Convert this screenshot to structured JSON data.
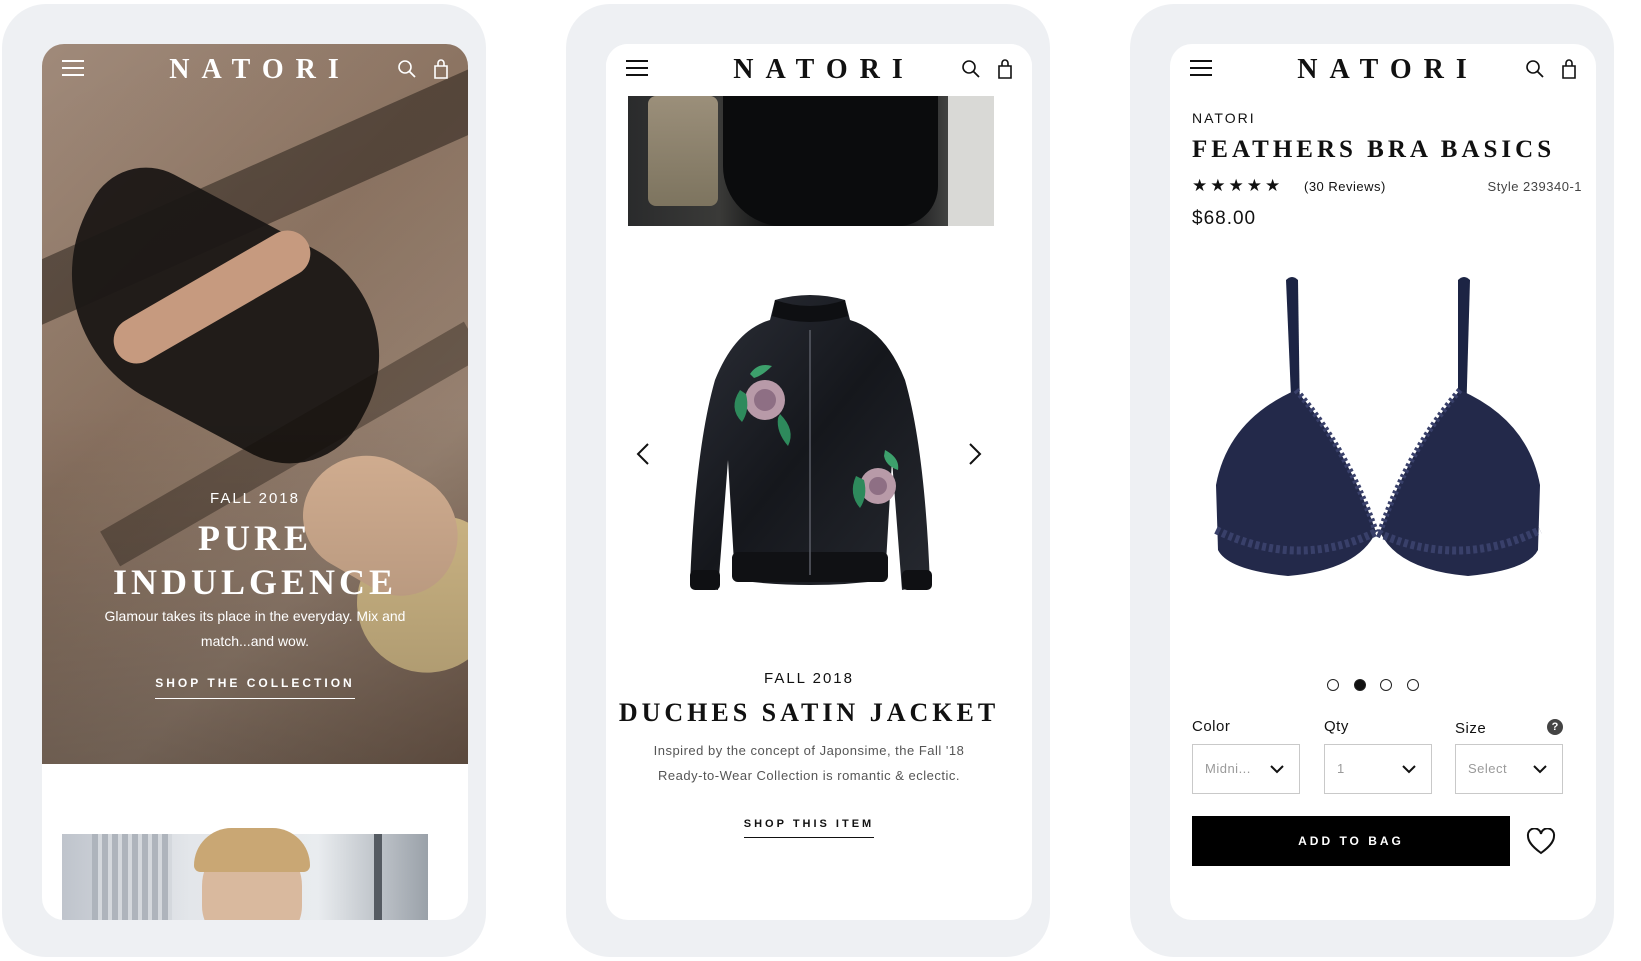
{
  "colors": {
    "frame_bg": "#eef0f3",
    "screen_bg": "#ffffff",
    "text_dark": "#111111",
    "button_black": "#000000",
    "hero_tone": "#8c7462"
  },
  "header": {
    "logo": "NATORI",
    "menu_icon": "hamburger-menu-icon",
    "search_icon": "search-icon",
    "bag_icon": "shopping-bag-icon"
  },
  "screen1": {
    "eyebrow": "FALL 2018",
    "title_line1": "PURE",
    "title_line2": "INDULGENCE",
    "description": "Glamour takes its place in the everyday. Mix and match...and wow.",
    "cta": "SHOP THE COLLECTION"
  },
  "screen2": {
    "eyebrow": "FALL 2018",
    "title": "DUCHES SATIN JACKET",
    "description_line1": "Inspired by the concept of Japonsime, the Fall '18",
    "description_line2": "Ready-to-Wear Collection is romantic & eclectic.",
    "cta": "SHOP THIS ITEM",
    "prev_icon": "chevron-left-icon",
    "next_icon": "chevron-right-icon"
  },
  "screen3": {
    "brand": "NATORI",
    "title": "FEATHERS BRA BASICS",
    "rating": 5,
    "stars": "★★★★★",
    "reviews": "(30 Reviews)",
    "style": "Style 239340-1",
    "price": "$68.00",
    "carousel": {
      "total": 4,
      "active": 2
    },
    "options": {
      "color": {
        "label": "Color",
        "value": "Midni..."
      },
      "qty": {
        "label": "Qty",
        "value": "1"
      },
      "size": {
        "label": "Size",
        "value": "Select"
      }
    },
    "help_icon": "?",
    "add_to_bag": "ADD TO BAG",
    "wishlist_icon": "heart-icon"
  }
}
